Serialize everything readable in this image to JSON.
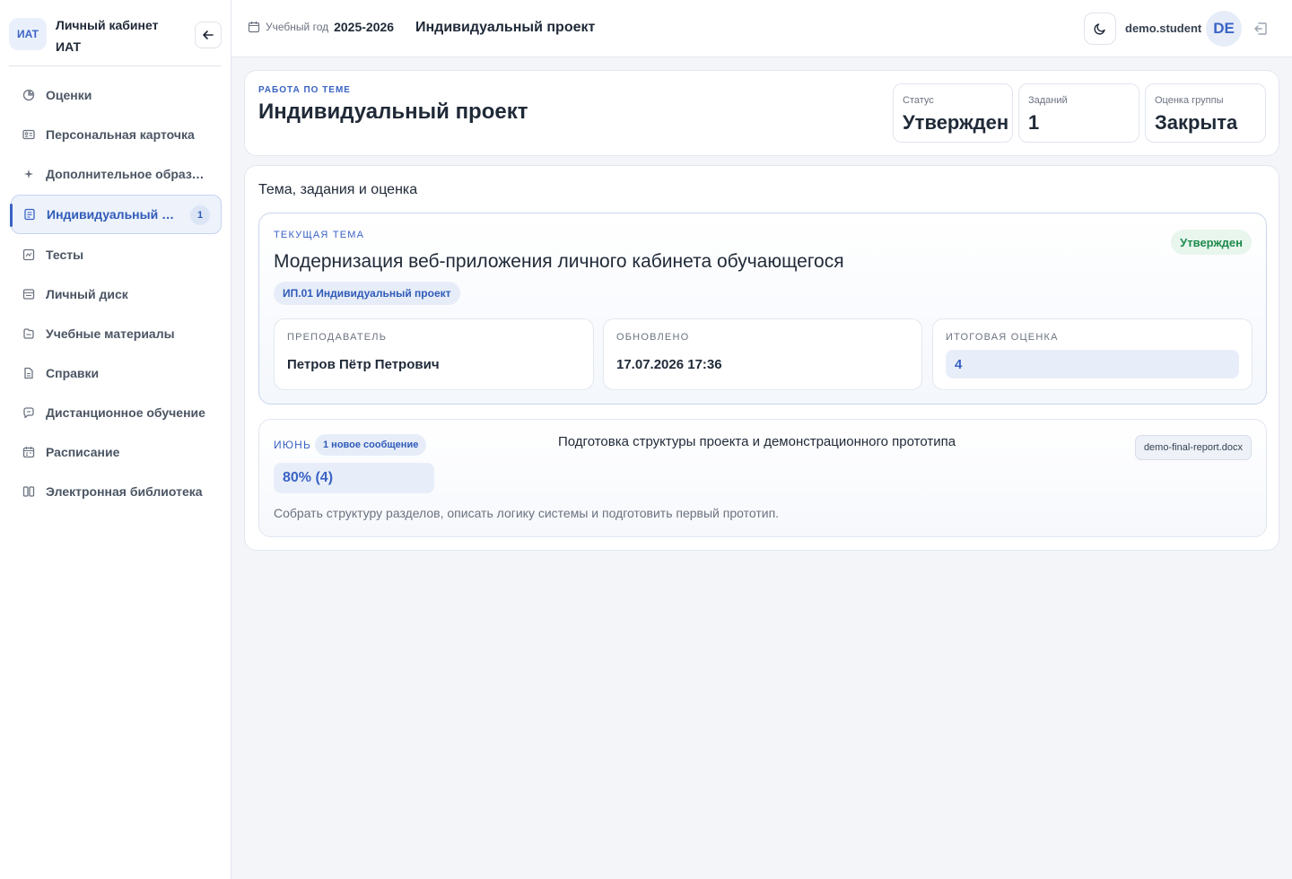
{
  "brand": {
    "logo": "ИАТ",
    "title": "Личный кабинет ИАТ"
  },
  "sidebar": {
    "items": [
      {
        "label": "Оценки",
        "icon": "chart-pie-icon"
      },
      {
        "label": "Персональная карточка",
        "icon": "id-card-icon"
      },
      {
        "label": "Дополнительное образование",
        "icon": "sparkle-icon"
      },
      {
        "label": "Индивидуальный проект",
        "icon": "document-icon",
        "active": true,
        "badge": "1"
      },
      {
        "label": "Тесты",
        "icon": "test-icon"
      },
      {
        "label": "Личный диск",
        "icon": "disk-icon"
      },
      {
        "label": "Учебные материалы",
        "icon": "materials-icon"
      },
      {
        "label": "Справки",
        "icon": "file-icon"
      },
      {
        "label": "Дистанционное обучение",
        "icon": "chat-icon"
      },
      {
        "label": "Расписание",
        "icon": "calendar-icon"
      },
      {
        "label": "Электронная библиотека",
        "icon": "book-icon"
      }
    ]
  },
  "header": {
    "year_label": "Учебный год",
    "year_value": "2025-2026",
    "title": "Индивидуальный проект",
    "username": "demo.student",
    "avatar": "DE"
  },
  "overview": {
    "kicker": "РАБОТА ПО ТЕМЕ",
    "title": "Индивидуальный проект",
    "stats": [
      {
        "label": "Статус",
        "value": "Утвержден"
      },
      {
        "label": "Заданий",
        "value": "1"
      },
      {
        "label": "Оценка группы",
        "value": "Закрыта"
      }
    ]
  },
  "details": {
    "title": "Тема, задания и оценка",
    "topic": {
      "kicker": "ТЕКУЩАЯ ТЕМА",
      "status": "Утвержден",
      "name": "Модернизация веб-приложения личного кабинета обучающегося",
      "tag": "ИП.01 Индивидуальный проект",
      "teacher_label": "ПРЕПОДАВАТЕЛЬ",
      "teacher": "Петров Пётр Петрович",
      "updated_label": "ОБНОВЛЕНО",
      "updated": "17.07.2026 17:36",
      "grade_label": "ИТОГОВАЯ ОЦЕНКА",
      "grade": "4"
    },
    "task": {
      "month": "ИЮНЬ",
      "messages": "1 новое сообщение",
      "progress": "80% (4)",
      "title": "Подготовка структуры проекта и демонстрационного прототипа",
      "file": "demo-final-report.docx",
      "description": "Собрать структуру разделов, описать логику системы и подготовить первый прототип."
    }
  },
  "colors": {
    "accent": "#3a63c4",
    "success": "#1f8a4c",
    "background": "#f3f5f9"
  }
}
